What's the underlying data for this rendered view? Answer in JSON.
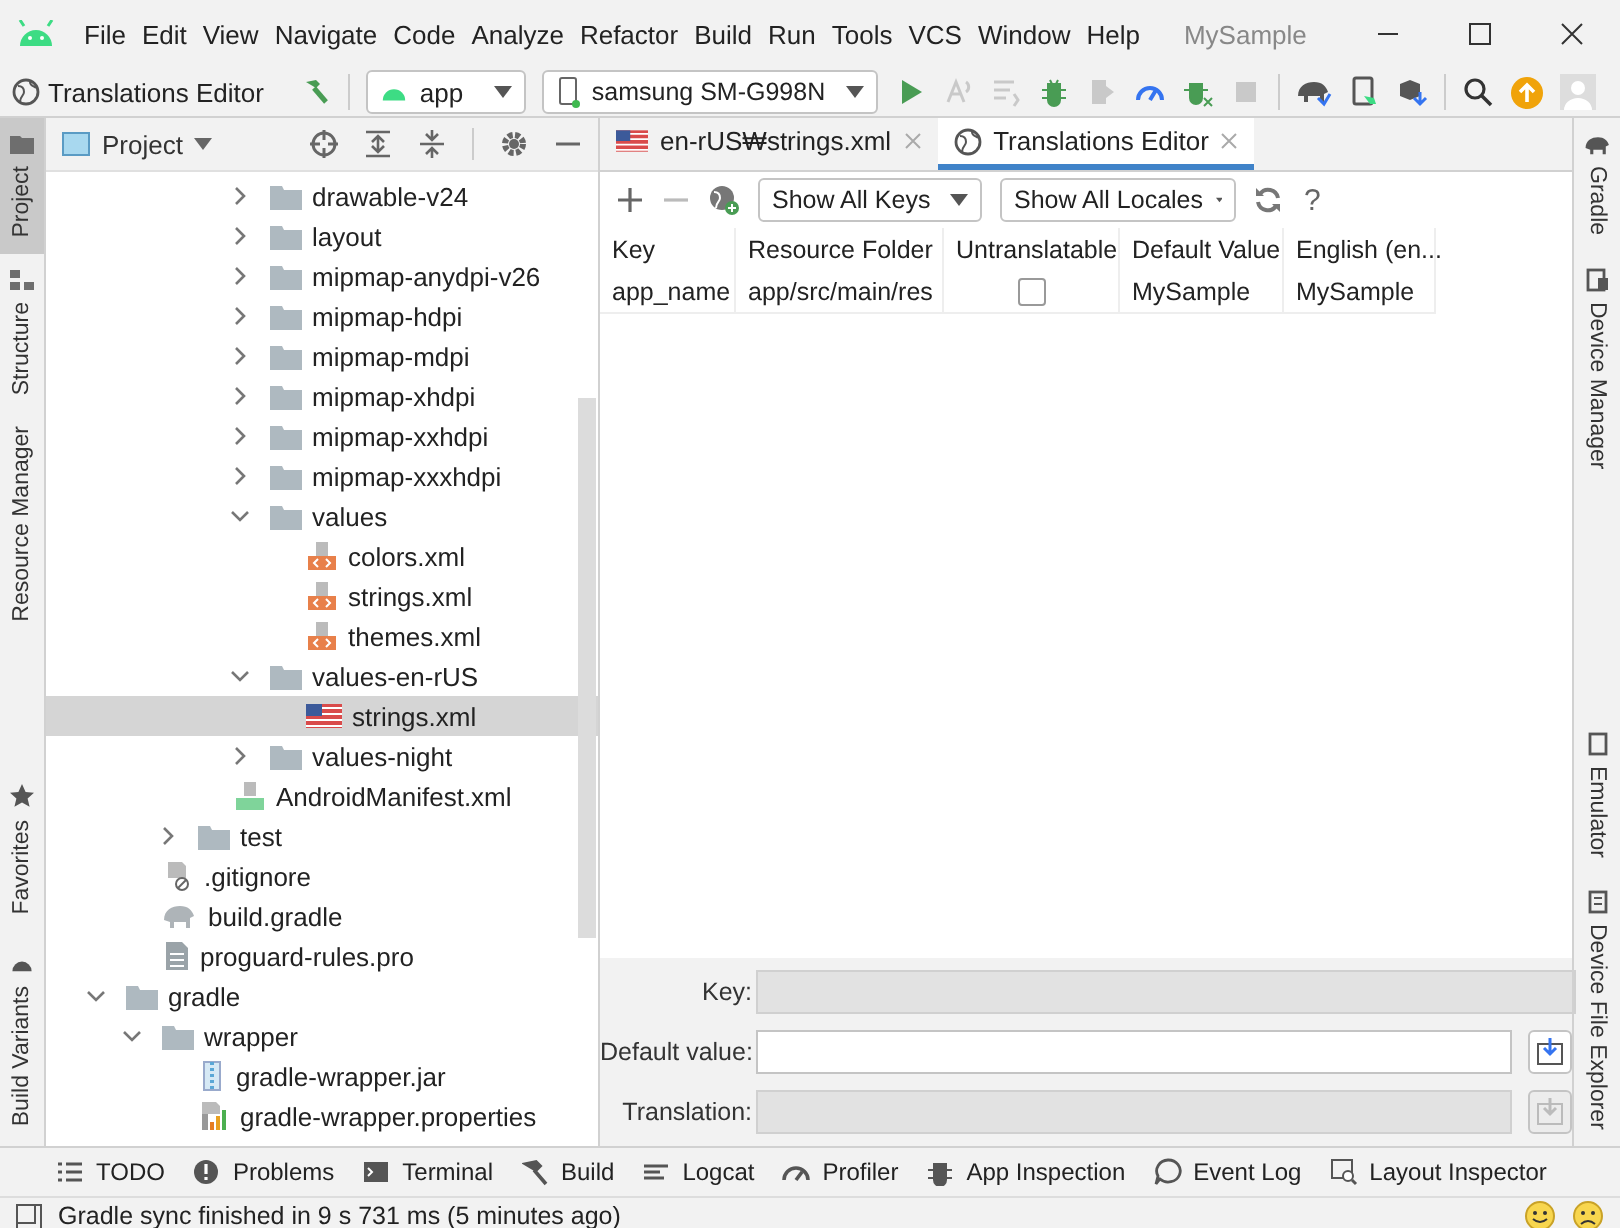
{
  "menu_bar": {
    "items": [
      "File",
      "Edit",
      "View",
      "Navigate",
      "Code",
      "Analyze",
      "Refactor",
      "Build",
      "Run",
      "Tools",
      "VCS",
      "Window",
      "Help"
    ],
    "project_title": "MySample"
  },
  "toolbar": {
    "breadcrumb": "Translations Editor",
    "module": "app",
    "device": "samsung SM-G998N",
    "actions": [
      {
        "kind": "run",
        "disabled": false
      },
      {
        "kind": "apply-changes",
        "disabled": true
      },
      {
        "kind": "apply-code",
        "disabled": true
      },
      {
        "kind": "debug",
        "disabled": false
      },
      {
        "kind": "attach",
        "disabled": true
      },
      {
        "kind": "profile",
        "disabled": false
      },
      {
        "kind": "debug-attach",
        "disabled": false
      },
      {
        "kind": "stop",
        "disabled": true
      }
    ]
  },
  "left_tool_windows_top": [
    {
      "label": "Project",
      "kind": "project",
      "selected": true
    },
    {
      "label": "Structure",
      "kind": "structure",
      "selected": false
    },
    {
      "label": "Resource Manager",
      "kind": "none",
      "selected": false
    }
  ],
  "left_tool_windows_bottom": [
    {
      "label": "Favorites",
      "kind": "favorites",
      "selected": false
    },
    {
      "label": "Build Variants",
      "kind": "variants",
      "selected": false
    }
  ],
  "project": {
    "view": "Project",
    "tree": [
      {
        "children": [
          {
            "children": [
              {
                "children": [
                  {
                    "children": [
                      {
                        "label": "drawable-v24",
                        "kind": "folder",
                        "expanded": false,
                        "selected": false
                      },
                      {
                        "label": "layout",
                        "kind": "folder",
                        "expanded": false,
                        "selected": false
                      },
                      {
                        "label": "mipmap-anydpi-v26",
                        "kind": "folder",
                        "expanded": false,
                        "selected": false
                      },
                      {
                        "label": "mipmap-hdpi",
                        "kind": "folder",
                        "expanded": false,
                        "selected": false
                      },
                      {
                        "label": "mipmap-mdpi",
                        "kind": "folder",
                        "expanded": false,
                        "selected": false
                      },
                      {
                        "label": "mipmap-xhdpi",
                        "kind": "folder",
                        "expanded": false,
                        "selected": false
                      },
                      {
                        "label": "mipmap-xxhdpi",
                        "kind": "folder",
                        "expanded": false,
                        "selected": false
                      },
                      {
                        "label": "mipmap-xxxhdpi",
                        "kind": "folder",
                        "expanded": false,
                        "selected": false
                      },
                      {
                        "label": "values",
                        "kind": "folder",
                        "expanded": true,
                        "selected": false,
                        "children": [
                          {
                            "label": "colors.xml",
                            "kind": "xml",
                            "selected": false
                          },
                          {
                            "label": "strings.xml",
                            "kind": "xml",
                            "selected": false
                          },
                          {
                            "label": "themes.xml",
                            "kind": "xml",
                            "selected": false
                          }
                        ]
                      },
                      {
                        "label": "values-en-rUS",
                        "kind": "folder",
                        "expanded": true,
                        "selected": false,
                        "children": [
                          {
                            "label": "strings.xml",
                            "kind": "flag-xml",
                            "selected": true
                          }
                        ]
                      },
                      {
                        "label": "values-night",
                        "kind": "folder",
                        "expanded": false,
                        "selected": false
                      }
                    ]
                  },
                  {
                    "label": "AndroidManifest.xml",
                    "kind": "manifest",
                    "selected": false
                  }
                ]
              },
              {
                "label": "test",
                "kind": "folder",
                "expanded": false,
                "selected": false
              }
            ]
          },
          {
            "label": ".gitignore",
            "kind": "ignore",
            "selected": false
          },
          {
            "label": "build.gradle",
            "kind": "gradle",
            "selected": false
          },
          {
            "label": "proguard-rules.pro",
            "kind": "text",
            "selected": false
          }
        ]
      },
      {
        "label": "gradle",
        "kind": "folder",
        "expanded": true,
        "selected": false,
        "children": [
          {
            "label": "wrapper",
            "kind": "folder",
            "expanded": true,
            "selected": false,
            "children": [
              {
                "label": "gradle-wrapper.jar",
                "kind": "jar",
                "selected": false
              },
              {
                "label": "gradle-wrapper.properties",
                "kind": "properties",
                "selected": false
              }
            ]
          }
        ]
      }
    ]
  },
  "editor": {
    "tabs": [
      {
        "label": "en-rUS₩strings.xml",
        "kind": "flag",
        "selected": false
      },
      {
        "label": "Translations Editor",
        "kind": "globe",
        "selected": true
      }
    ],
    "keys_filter": "Show All Keys",
    "locales_filter": "Show All Locales",
    "help": "?",
    "table": {
      "columns": [
        "Key",
        "Resource Folder",
        "Untranslatable",
        "Default Value",
        "English (en..."
      ],
      "rows": [
        {
          "key": "app_name",
          "folder": "app/src/main/res",
          "untranslatable": false,
          "default": "MySample",
          "english": "MySample"
        }
      ]
    },
    "form": [
      {
        "label": "Key:",
        "disabled": true,
        "button": false
      },
      {
        "label": "Default value:",
        "disabled": false,
        "button": true
      },
      {
        "label": "Translation:",
        "disabled": true,
        "button": true
      }
    ]
  },
  "right_tool_windows_top": [
    {
      "label": "Gradle",
      "kind": "gradle"
    },
    {
      "label": "Device Manager",
      "kind": "device"
    }
  ],
  "right_tool_windows_bottom": [
    {
      "label": "Emulator",
      "kind": "emulator"
    },
    {
      "label": "Device File Explorer",
      "kind": "files"
    }
  ],
  "bottom_tools": [
    {
      "label": "TODO",
      "kind": "list"
    },
    {
      "label": "Problems",
      "kind": "problems"
    },
    {
      "label": "Terminal",
      "kind": "terminal"
    },
    {
      "label": "Build",
      "kind": "hammer"
    },
    {
      "label": "Logcat",
      "kind": "logcat"
    },
    {
      "label": "Profiler",
      "kind": "gauge"
    },
    {
      "label": "App Inspection",
      "kind": "inspect"
    },
    {
      "label": "Event Log",
      "kind": "bubble"
    },
    {
      "label": "Layout Inspector",
      "kind": "layout"
    }
  ],
  "status_bar": {
    "message": "Gradle sync finished in 9 s 731 ms (5 minutes ago)"
  }
}
